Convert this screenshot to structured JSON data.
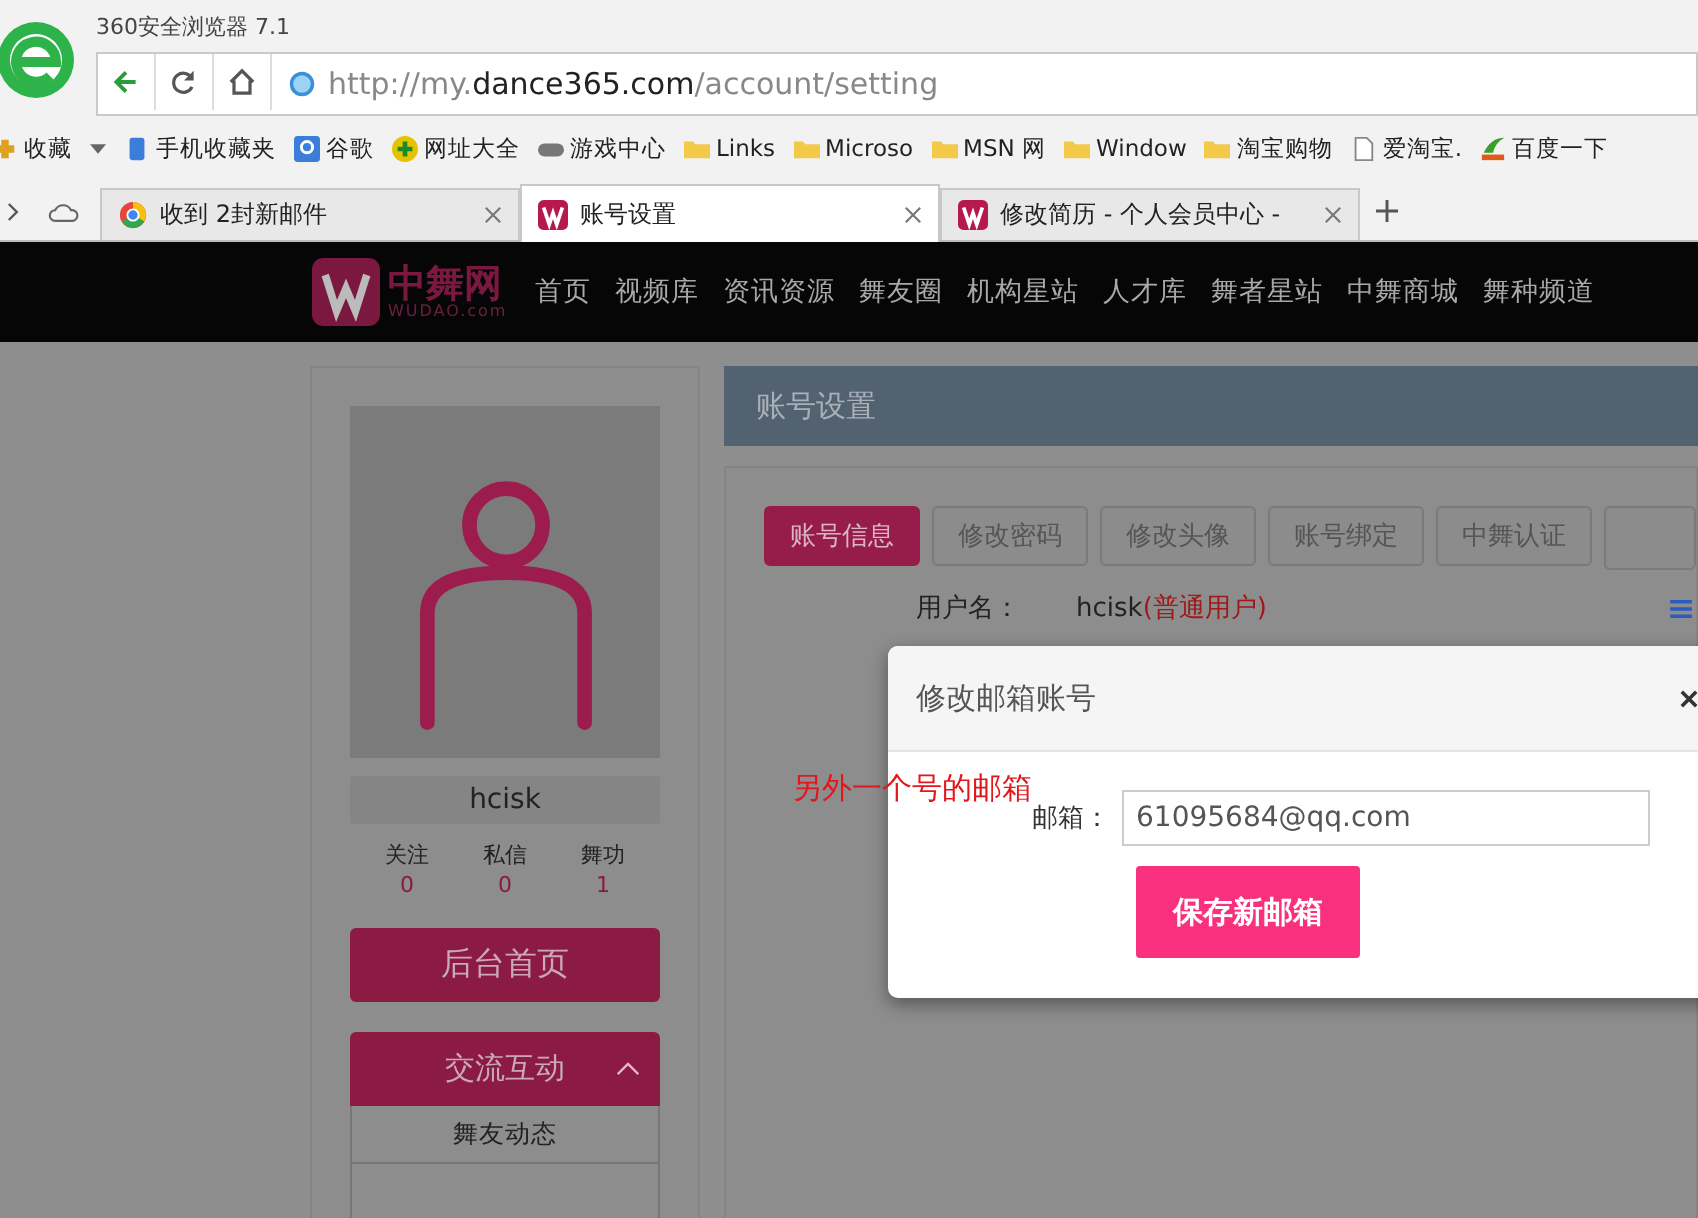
{
  "browser": {
    "title": "360安全浏览器 7.1",
    "url": {
      "prefix": "http://my.",
      "domain": "dance365.com",
      "path": "/account/setting"
    },
    "bookmarks": [
      {
        "label": "收藏",
        "kind": "favorites"
      },
      {
        "label": "手机收藏夹",
        "kind": "phone"
      },
      {
        "label": "谷歌",
        "kind": "search"
      },
      {
        "label": "网址大全",
        "kind": "plus"
      },
      {
        "label": "游戏中心",
        "kind": "game"
      },
      {
        "label": "Links",
        "kind": "folder"
      },
      {
        "label": "Microso",
        "kind": "folder"
      },
      {
        "label": "MSN 网",
        "kind": "folder"
      },
      {
        "label": "Window",
        "kind": "folder"
      },
      {
        "label": "淘宝购物",
        "kind": "folder"
      },
      {
        "label": "爱淘宝.",
        "kind": "page"
      },
      {
        "label": "百度一下",
        "kind": "hao"
      }
    ],
    "tabs": [
      {
        "label": "收到 2封新邮件",
        "selected": false,
        "kind": "mail"
      },
      {
        "label": "账号设置",
        "selected": true,
        "kind": "site"
      },
      {
        "label": "修改简历 - 个人会员中心 -",
        "selected": false,
        "kind": "site"
      }
    ]
  },
  "site": {
    "logo": {
      "name": "中舞网",
      "domain": "WUDAO.com"
    },
    "nav": [
      "首页",
      "视频库",
      "资讯资源",
      "舞友圈",
      "机构星站",
      "人才库",
      "舞者星站",
      "中舞商城",
      "舞种频道"
    ]
  },
  "sidebar": {
    "username": "hcisk",
    "stats": [
      {
        "label": "关注",
        "value": "0"
      },
      {
        "label": "私信",
        "value": "0"
      },
      {
        "label": "舞功",
        "value": "1"
      }
    ],
    "home_button": "后台首页",
    "section": {
      "title": "交流互动",
      "expanded": true,
      "items": [
        "舞友动态"
      ]
    }
  },
  "main": {
    "title": "账号设置",
    "tabs": [
      {
        "label": "账号信息",
        "selected": true
      },
      {
        "label": "修改密码",
        "selected": false
      },
      {
        "label": "修改头像",
        "selected": false
      },
      {
        "label": "账号绑定",
        "selected": false
      },
      {
        "label": "中舞认证",
        "selected": false
      }
    ],
    "field": {
      "label": "用户名：",
      "value": "hcisk",
      "role": "(普通用户)"
    }
  },
  "annotation": "另外一个号的邮箱",
  "modal": {
    "title": "修改邮箱账号",
    "email_label": "邮箱：",
    "email_value": "61095684@qq.com",
    "submit": "保存新邮箱"
  }
}
